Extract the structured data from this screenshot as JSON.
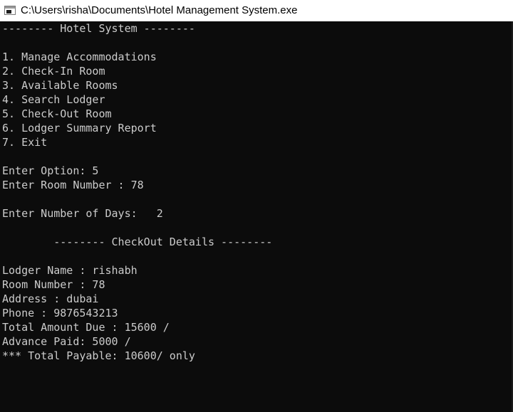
{
  "window": {
    "title": "C:\\Users\\risha\\Documents\\Hotel Management System.exe"
  },
  "console": {
    "lines": [
      "-------- Hotel System --------",
      "",
      "1. Manage Accommodations",
      "2. Check-In Room",
      "3. Available Rooms",
      "4. Search Lodger",
      "5. Check-Out Room",
      "6. Lodger Summary Report",
      "7. Exit",
      "",
      "Enter Option: 5",
      "Enter Room Number : 78",
      "",
      "Enter Number of Days:   2",
      "",
      "        -------- CheckOut Details --------",
      "",
      "Lodger Name : rishabh",
      "Room Number : 78",
      "Address : dubai",
      "Phone : 9876543213",
      "Total Amount Due : 15600 /",
      "Advance Paid: 5000 /",
      "*** Total Payable: 10600/ only"
    ]
  },
  "colors": {
    "background": "#0c0c0c",
    "text": "#cccccc",
    "titlebar": "#ffffff"
  },
  "icons": {
    "app": "console-window-icon"
  }
}
